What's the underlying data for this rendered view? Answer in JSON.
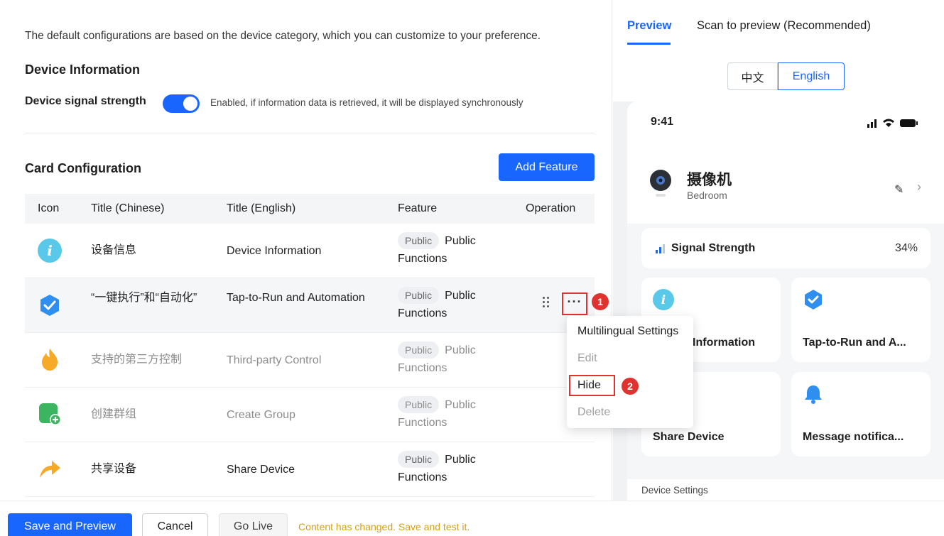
{
  "intro": "The default configurations are based on the device category, which you can customize to your preference.",
  "device_info": {
    "title": "Device Information",
    "signal_label": "Device signal strength",
    "signal_enabled": true,
    "signal_desc": "Enabled, if information data is retrieved, it will be displayed synchronously"
  },
  "card_config": {
    "title": "Card Configuration",
    "add_button": "Add Feature",
    "columns": [
      "Icon",
      "Title (Chinese)",
      "Title (English)",
      "Feature",
      "Operation"
    ],
    "rows": [
      {
        "icon": "info-icon",
        "title_cn": "设备信息",
        "title_en": "Device Information",
        "tag": "Public",
        "feature": "Public Functions",
        "hidden": false
      },
      {
        "icon": "shield-check-icon",
        "title_cn": "“一键执行”和“自动化”",
        "title_en": "Tap-to-Run and Automation",
        "tag": "Public",
        "feature": "Public Functions",
        "hidden": false
      },
      {
        "icon": "flame-icon",
        "title_cn": "支持的第三方控制",
        "title_en": "Third-party Control",
        "tag": "Public",
        "feature": "Public Functions",
        "hidden": true
      },
      {
        "icon": "group-add-icon",
        "title_cn": "创建群组",
        "title_en": "Create Group",
        "tag": "Public",
        "feature": "Public Functions",
        "hidden": true
      },
      {
        "icon": "share-arrow-icon",
        "title_cn": "共享设备",
        "title_en": "Share Device",
        "tag": "Public",
        "feature": "Public Functions",
        "hidden": false
      }
    ],
    "more_button": "···",
    "badge1": "1",
    "badge2": "2"
  },
  "menu": {
    "items": [
      "Multilingual Settings",
      "Edit",
      "Hide",
      "Delete"
    ]
  },
  "bottom": {
    "save_preview": "Save and Preview",
    "cancel": "Cancel",
    "go_live": "Go Live",
    "changed_msg": "Content has changed. Save and test it."
  },
  "preview": {
    "tabs": [
      "Preview",
      "Scan to preview (Recommended)"
    ],
    "languages": [
      "中文",
      "English"
    ],
    "time": "9:41",
    "device_title": "摄像机",
    "device_room": "Bedroom",
    "signal_label": "Signal Strength",
    "signal_value": "34%",
    "tiles": [
      "Device Information",
      "Tap-to-Run and A...",
      "Share Device",
      "Message notifica..."
    ],
    "settings_label": "Device Settings"
  },
  "colors": {
    "primary": "#1966ff",
    "alert": "#e0322e",
    "warning_text": "#d4a017"
  }
}
